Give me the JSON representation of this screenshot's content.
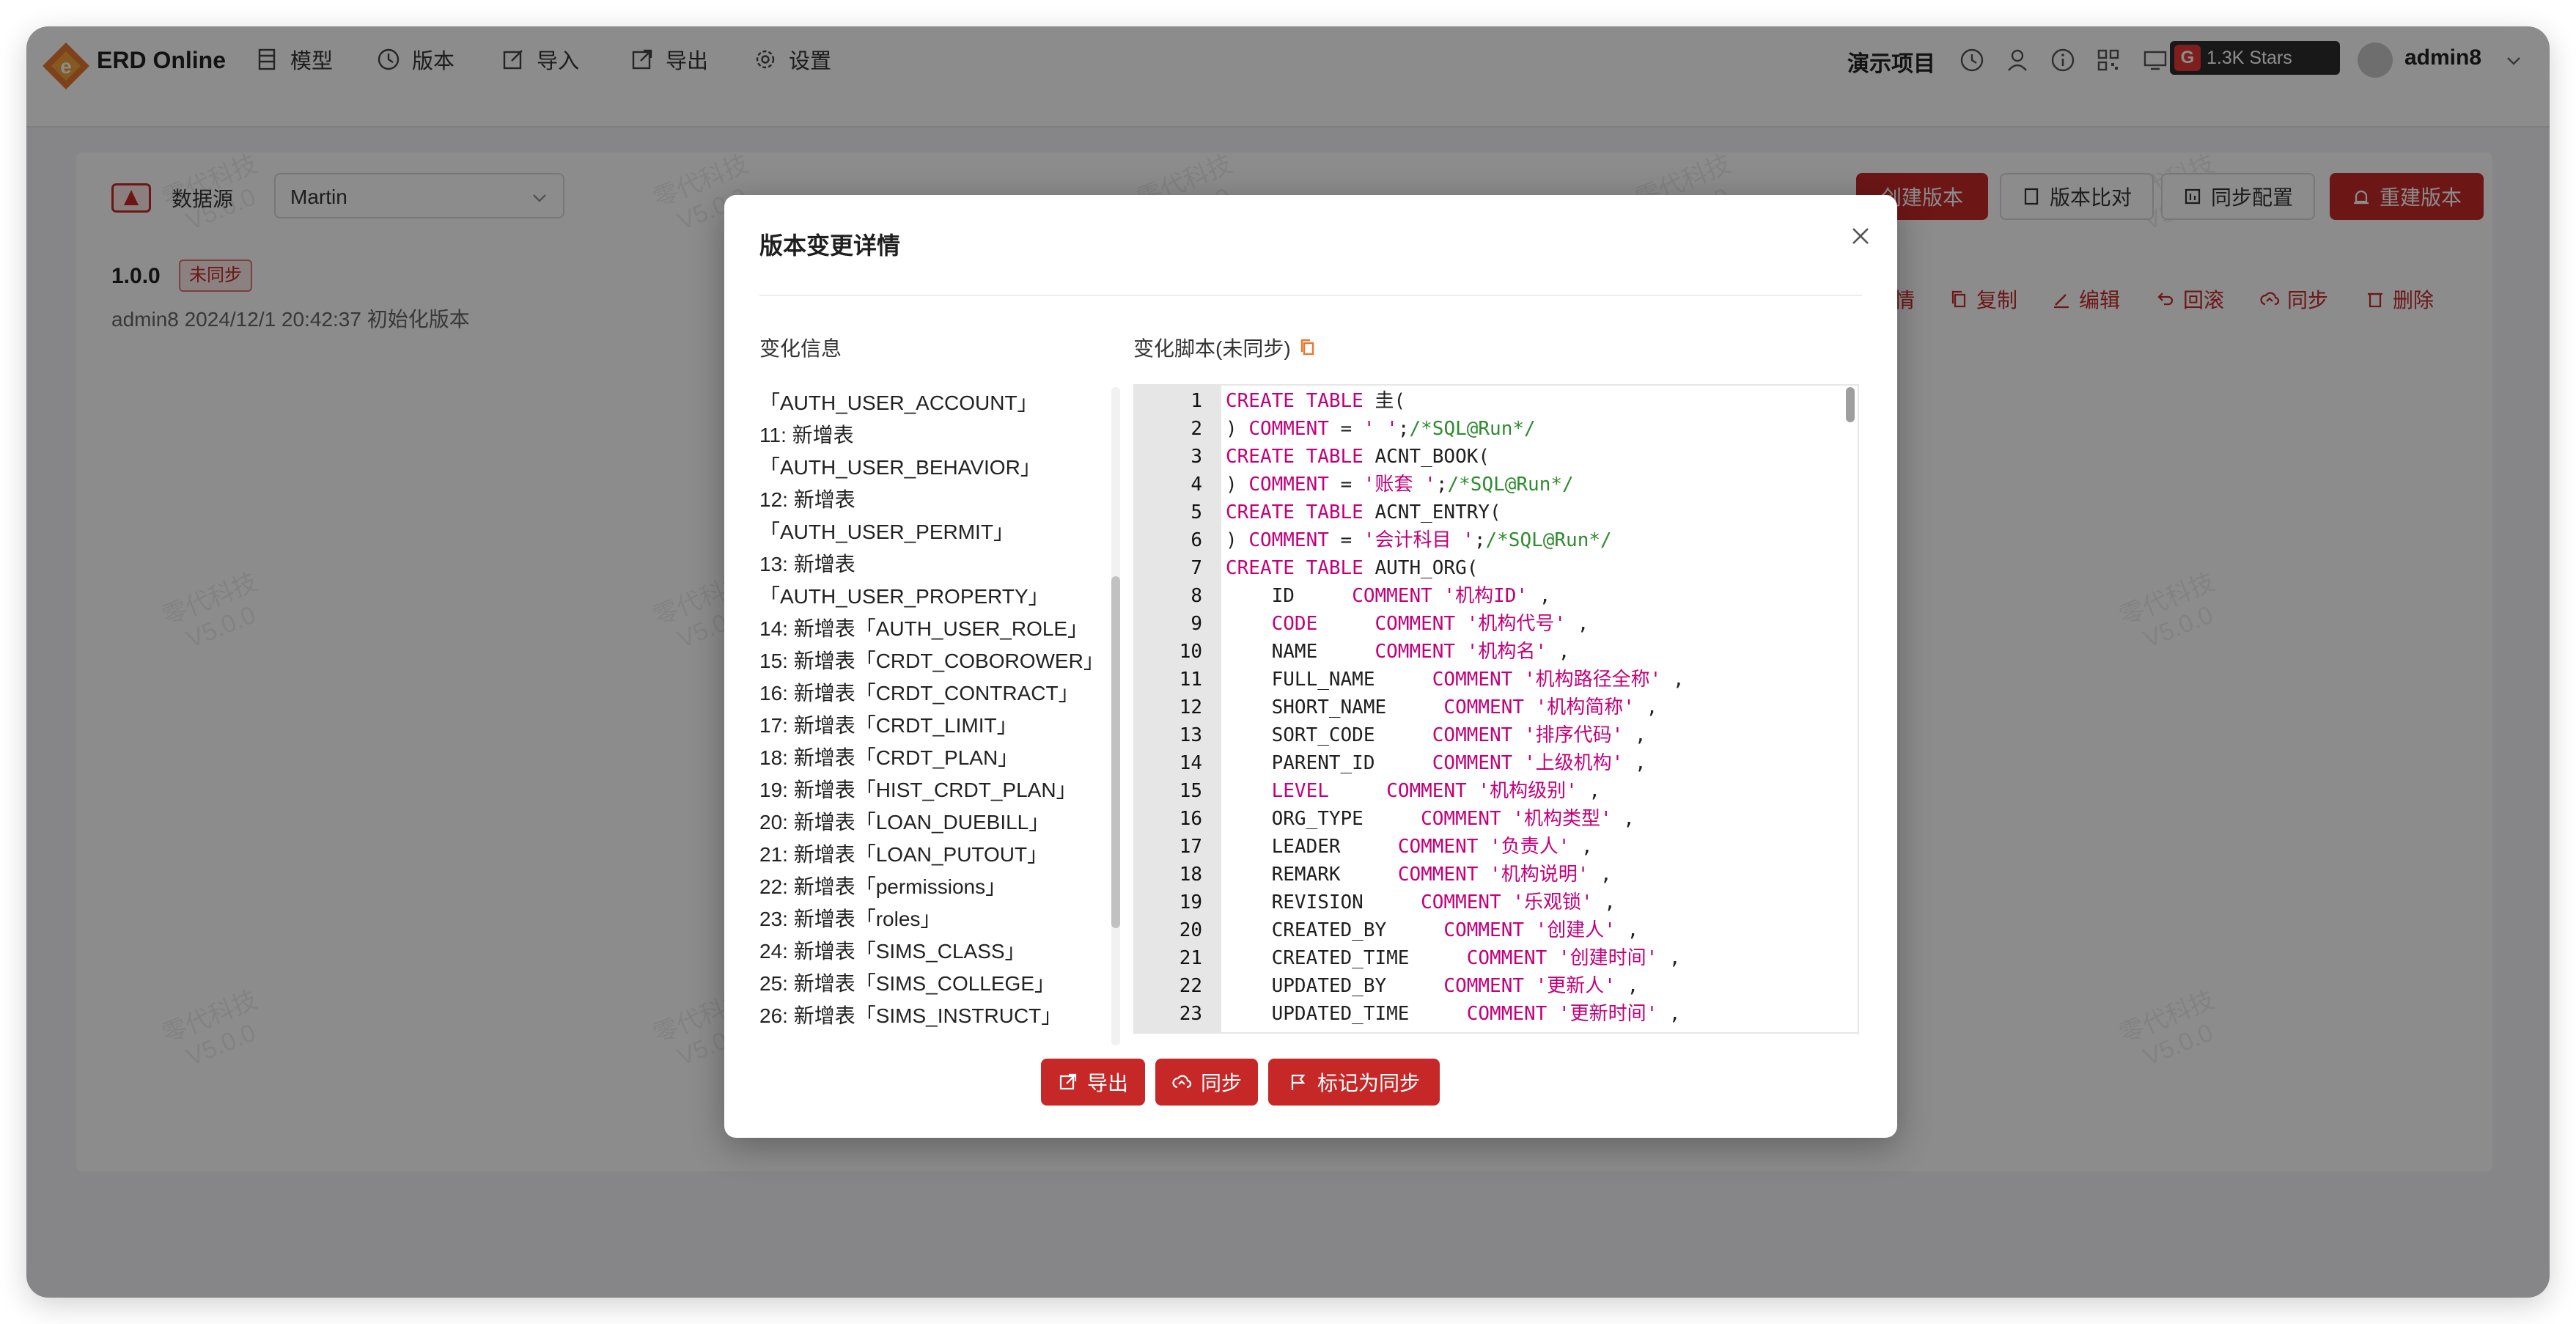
{
  "app": {
    "brand": "ERD Online"
  },
  "nav": [
    {
      "label": "模型",
      "icon": "table-icon"
    },
    {
      "label": "版本",
      "icon": "history-icon"
    },
    {
      "label": "导入",
      "icon": "import-icon"
    },
    {
      "label": "导出",
      "icon": "export-icon"
    },
    {
      "label": "设置",
      "icon": "gear-icon"
    }
  ],
  "header": {
    "project": "演示项目",
    "stars": "1.3K Stars",
    "user": "admin8"
  },
  "page": {
    "datasource_label": "数据源",
    "datasource_value": "Martin",
    "version": "1.0.0",
    "version_status": "未同步",
    "version_meta": "admin8   2024/12/1 20:42:37   初始化版本",
    "buttons": {
      "create": "创建版本",
      "compare": "版本比对",
      "sync_config": "同步配置",
      "rebuild": "重建版本"
    },
    "actions": {
      "detail": "详情",
      "copy": "复制",
      "edit": "编辑",
      "rollback": "回滚",
      "sync": "同步",
      "delete": "删除"
    },
    "watermark_line1": "零代科技",
    "watermark_line2": "V5.0.0"
  },
  "modal": {
    "title": "版本变更详情",
    "left_title": "变化信息",
    "right_title": "变化脚本(未同步)",
    "changes": [
      "「AUTH_USER_ACCOUNT」",
      "11: 新增表",
      "「AUTH_USER_BEHAVIOR」",
      "12: 新增表",
      "「AUTH_USER_PERMIT」",
      "13: 新增表",
      "「AUTH_USER_PROPERTY」",
      "14: 新增表「AUTH_USER_ROLE」",
      "15: 新增表「CRDT_COBOROWER」",
      "16: 新增表「CRDT_CONTRACT」",
      "17: 新增表「CRDT_LIMIT」",
      "18: 新增表「CRDT_PLAN」",
      "19: 新增表「HIST_CRDT_PLAN」",
      "20: 新增表「LOAN_DUEBILL」",
      "21: 新增表「LOAN_PUTOUT」",
      "22: 新增表「permissions」",
      "23: 新增表「roles」",
      "24: 新增表「SIMS_CLASS」",
      "25: 新增表「SIMS_COLLEGE」",
      "26: 新增表「SIMS_INSTRUCT」"
    ],
    "code": [
      {
        "n": "1",
        "parts": [
          [
            "kw",
            "CREATE TABLE"
          ],
          [
            "tx",
            " 圭("
          ]
        ]
      },
      {
        "n": "2",
        "parts": [
          [
            "tx",
            ") "
          ],
          [
            "kw",
            "COMMENT"
          ],
          [
            "tx",
            " = "
          ],
          [
            "st",
            "' '"
          ],
          [
            "tx",
            ";"
          ],
          [
            "cm",
            "/*SQL@Run*/"
          ]
        ]
      },
      {
        "n": "3",
        "parts": [
          [
            "kw",
            "CREATE TABLE"
          ],
          [
            "tx",
            " ACNT_BOOK("
          ]
        ]
      },
      {
        "n": "4",
        "parts": [
          [
            "tx",
            ") "
          ],
          [
            "kw",
            "COMMENT"
          ],
          [
            "tx",
            " = "
          ],
          [
            "st",
            "'账套 '"
          ],
          [
            "tx",
            ";"
          ],
          [
            "cm",
            "/*SQL@Run*/"
          ]
        ]
      },
      {
        "n": "5",
        "parts": [
          [
            "kw",
            "CREATE TABLE"
          ],
          [
            "tx",
            " ACNT_ENTRY("
          ]
        ]
      },
      {
        "n": "6",
        "parts": [
          [
            "tx",
            ") "
          ],
          [
            "kw",
            "COMMENT"
          ],
          [
            "tx",
            " = "
          ],
          [
            "st",
            "'会计科目 '"
          ],
          [
            "tx",
            ";"
          ],
          [
            "cm",
            "/*SQL@Run*/"
          ]
        ]
      },
      {
        "n": "7",
        "parts": [
          [
            "kw",
            "CREATE TABLE"
          ],
          [
            "tx",
            " AUTH_ORG("
          ]
        ]
      },
      {
        "n": "8",
        "parts": [
          [
            "tx",
            "    ID     "
          ],
          [
            "kw",
            "COMMENT"
          ],
          [
            "tx",
            " "
          ],
          [
            "st",
            "'机构ID'"
          ],
          [
            "tx",
            " ,"
          ]
        ]
      },
      {
        "n": "9",
        "parts": [
          [
            "tx",
            "    "
          ],
          [
            "kw",
            "CODE"
          ],
          [
            "tx",
            "     "
          ],
          [
            "kw",
            "COMMENT"
          ],
          [
            "tx",
            " "
          ],
          [
            "st",
            "'机构代号'"
          ],
          [
            "tx",
            " ,"
          ]
        ]
      },
      {
        "n": "10",
        "parts": [
          [
            "tx",
            "    NAME     "
          ],
          [
            "kw",
            "COMMENT"
          ],
          [
            "tx",
            " "
          ],
          [
            "st",
            "'机构名'"
          ],
          [
            "tx",
            " ,"
          ]
        ]
      },
      {
        "n": "11",
        "parts": [
          [
            "tx",
            "    FULL_NAME     "
          ],
          [
            "kw",
            "COMMENT"
          ],
          [
            "tx",
            " "
          ],
          [
            "st",
            "'机构路径全称'"
          ],
          [
            "tx",
            " ,"
          ]
        ]
      },
      {
        "n": "12",
        "parts": [
          [
            "tx",
            "    SHORT_NAME     "
          ],
          [
            "kw",
            "COMMENT"
          ],
          [
            "tx",
            " "
          ],
          [
            "st",
            "'机构简称'"
          ],
          [
            "tx",
            " ,"
          ]
        ]
      },
      {
        "n": "13",
        "parts": [
          [
            "tx",
            "    SORT_CODE     "
          ],
          [
            "kw",
            "COMMENT"
          ],
          [
            "tx",
            " "
          ],
          [
            "st",
            "'排序代码'"
          ],
          [
            "tx",
            " ,"
          ]
        ]
      },
      {
        "n": "14",
        "parts": [
          [
            "tx",
            "    PARENT_ID     "
          ],
          [
            "kw",
            "COMMENT"
          ],
          [
            "tx",
            " "
          ],
          [
            "st",
            "'上级机构'"
          ],
          [
            "tx",
            " ,"
          ]
        ]
      },
      {
        "n": "15",
        "parts": [
          [
            "tx",
            "    "
          ],
          [
            "kw",
            "LEVEL"
          ],
          [
            "tx",
            "     "
          ],
          [
            "kw",
            "COMMENT"
          ],
          [
            "tx",
            " "
          ],
          [
            "st",
            "'机构级别'"
          ],
          [
            "tx",
            " ,"
          ]
        ]
      },
      {
        "n": "16",
        "parts": [
          [
            "tx",
            "    ORG_TYPE     "
          ],
          [
            "kw",
            "COMMENT"
          ],
          [
            "tx",
            " "
          ],
          [
            "st",
            "'机构类型'"
          ],
          [
            "tx",
            " ,"
          ]
        ]
      },
      {
        "n": "17",
        "parts": [
          [
            "tx",
            "    LEADER     "
          ],
          [
            "kw",
            "COMMENT"
          ],
          [
            "tx",
            " "
          ],
          [
            "st",
            "'负责人'"
          ],
          [
            "tx",
            " ,"
          ]
        ]
      },
      {
        "n": "18",
        "parts": [
          [
            "tx",
            "    REMARK     "
          ],
          [
            "kw",
            "COMMENT"
          ],
          [
            "tx",
            " "
          ],
          [
            "st",
            "'机构说明'"
          ],
          [
            "tx",
            " ,"
          ]
        ]
      },
      {
        "n": "19",
        "parts": [
          [
            "tx",
            "    REVISION     "
          ],
          [
            "kw",
            "COMMENT"
          ],
          [
            "tx",
            " "
          ],
          [
            "st",
            "'乐观锁'"
          ],
          [
            "tx",
            " ,"
          ]
        ]
      },
      {
        "n": "20",
        "parts": [
          [
            "tx",
            "    CREATED_BY     "
          ],
          [
            "kw",
            "COMMENT"
          ],
          [
            "tx",
            " "
          ],
          [
            "st",
            "'创建人'"
          ],
          [
            "tx",
            " ,"
          ]
        ]
      },
      {
        "n": "21",
        "parts": [
          [
            "tx",
            "    CREATED_TIME     "
          ],
          [
            "kw",
            "COMMENT"
          ],
          [
            "tx",
            " "
          ],
          [
            "st",
            "'创建时间'"
          ],
          [
            "tx",
            " ,"
          ]
        ]
      },
      {
        "n": "22",
        "parts": [
          [
            "tx",
            "    UPDATED_BY     "
          ],
          [
            "kw",
            "COMMENT"
          ],
          [
            "tx",
            " "
          ],
          [
            "st",
            "'更新人'"
          ],
          [
            "tx",
            " ,"
          ]
        ]
      },
      {
        "n": "23",
        "parts": [
          [
            "tx",
            "    UPDATED_TIME     "
          ],
          [
            "kw",
            "COMMENT"
          ],
          [
            "tx",
            " "
          ],
          [
            "st",
            "'更新时间'"
          ],
          [
            "tx",
            " ,"
          ]
        ]
      }
    ],
    "buttons": {
      "export": "导出",
      "sync": "同步",
      "mark": "标记为同步"
    }
  },
  "colors": {
    "accent": "#c62828",
    "keyword": "#c2007a",
    "comment": "#2e8b2e"
  }
}
